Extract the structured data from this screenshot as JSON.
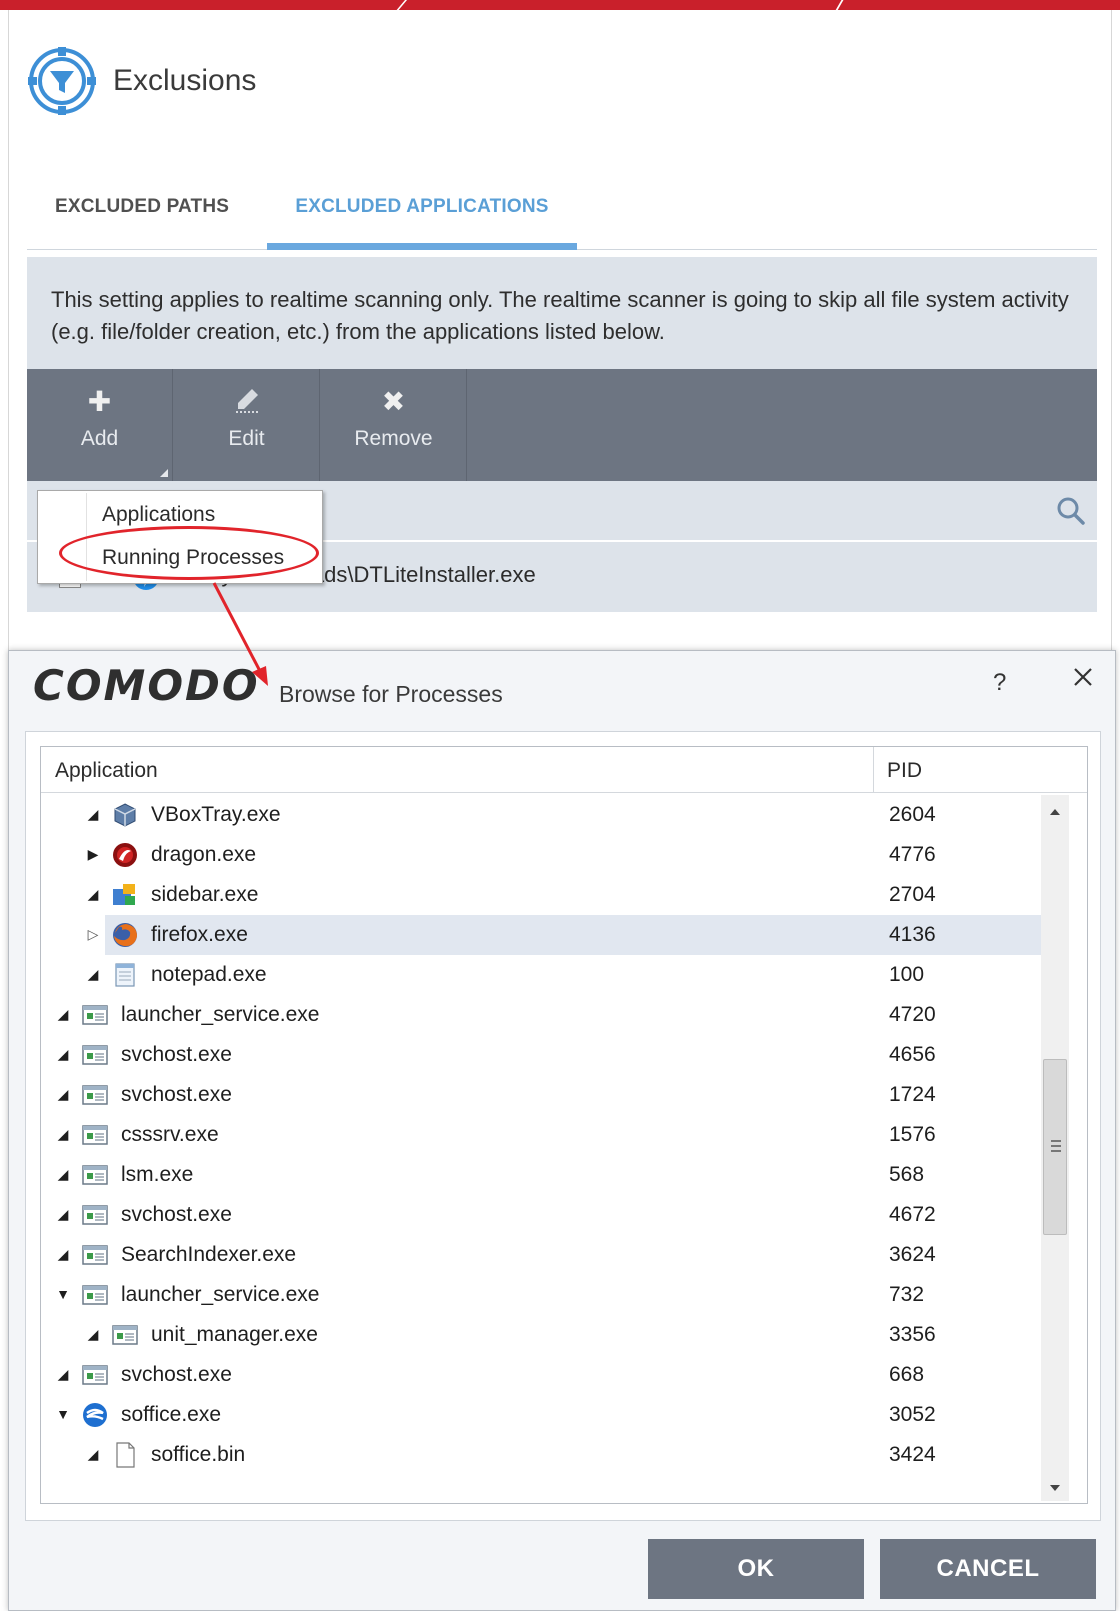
{
  "exclusions": {
    "title": "Exclusions",
    "tabs": [
      {
        "label": "EXCLUDED PATHS",
        "active": false
      },
      {
        "label": "EXCLUDED APPLICATIONS",
        "active": true
      }
    ],
    "info_text": "This setting applies to realtime scanning only. The realtime scanner is going to skip all file system activity (e.g. file/folder creation, etc.) from the applications listed below.",
    "toolbar": {
      "add_label": "Add",
      "edit_label": "Edit",
      "remove_label": "Remove"
    },
    "add_menu": {
      "items": [
        {
          "label": "Applications"
        },
        {
          "label": "Running Processes",
          "highlighted": true
        }
      ]
    },
    "excluded_apps": [
      {
        "path": "C:\\My Downloads\\DTLiteInstaller.exe",
        "checked": false
      }
    ]
  },
  "dialog": {
    "brand": "COMODO",
    "title": "Browse for Processes",
    "help_label": "?",
    "columns": {
      "application": "Application",
      "pid": "PID"
    },
    "processes": [
      {
        "name": "VBoxTray.exe",
        "pid": "2604",
        "level": 1,
        "expander": "filled-right-down",
        "icon": "vbox-icon"
      },
      {
        "name": "dragon.exe",
        "pid": "4776",
        "level": 1,
        "expander": "filled-right",
        "icon": "dragon-icon"
      },
      {
        "name": "sidebar.exe",
        "pid": "2704",
        "level": 1,
        "expander": "filled-right-down",
        "icon": "sidebar-icon"
      },
      {
        "name": "firefox.exe",
        "pid": "4136",
        "level": 1,
        "expander": "hollow-right",
        "icon": "firefox-icon",
        "selected": true
      },
      {
        "name": "notepad.exe",
        "pid": "100",
        "level": 1,
        "expander": "filled-right-down",
        "icon": "notepad-icon"
      },
      {
        "name": "launcher_service.exe",
        "pid": "4720",
        "level": 0,
        "expander": "filled-right-down",
        "icon": "window-icon"
      },
      {
        "name": "svchost.exe",
        "pid": "4656",
        "level": 0,
        "expander": "filled-right-down",
        "icon": "window-icon"
      },
      {
        "name": "svchost.exe",
        "pid": "1724",
        "level": 0,
        "expander": "filled-right-down",
        "icon": "window-icon"
      },
      {
        "name": "csssrv.exe",
        "pid": "1576",
        "level": 0,
        "expander": "filled-right-down",
        "icon": "window-icon"
      },
      {
        "name": "lsm.exe",
        "pid": "568",
        "level": 0,
        "expander": "filled-right-down",
        "icon": "window-icon"
      },
      {
        "name": "svchost.exe",
        "pid": "4672",
        "level": 0,
        "expander": "filled-right-down",
        "icon": "window-icon"
      },
      {
        "name": "SearchIndexer.exe",
        "pid": "3624",
        "level": 0,
        "expander": "filled-right-down",
        "icon": "window-icon"
      },
      {
        "name": "launcher_service.exe",
        "pid": "732",
        "level": 0,
        "expander": "expanded-down",
        "icon": "window-icon"
      },
      {
        "name": "unit_manager.exe",
        "pid": "3356",
        "level": 1,
        "expander": "filled-right-down",
        "icon": "window-icon"
      },
      {
        "name": "svchost.exe",
        "pid": "668",
        "level": 0,
        "expander": "filled-right-down",
        "icon": "window-icon"
      },
      {
        "name": "soffice.exe",
        "pid": "3052",
        "level": 0,
        "expander": "expanded-down",
        "icon": "soffice-icon"
      },
      {
        "name": "soffice.bin",
        "pid": "3424",
        "level": 1,
        "expander": "filled-right-down",
        "icon": "file-icon"
      }
    ],
    "buttons": {
      "ok_label": "OK",
      "cancel_label": "CANCEL"
    }
  },
  "colors": {
    "accent_red": "#c9202b",
    "tab_active_blue": "#5a9fd6",
    "toolbar_gray": "#6d7582",
    "panel_bg": "#dde3ea",
    "annotation_red": "#e1242b"
  }
}
